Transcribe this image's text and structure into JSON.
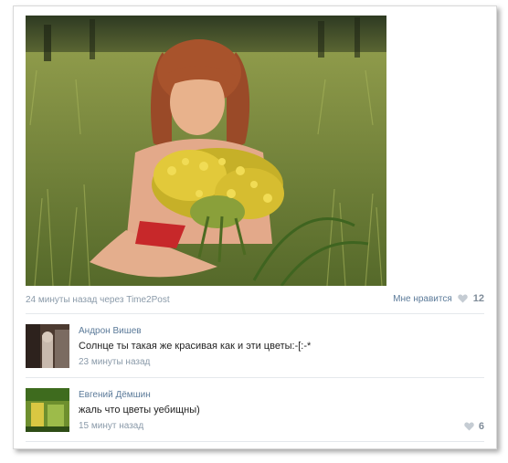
{
  "post": {
    "meta": "24 минуты назад через Time2Post",
    "like_label": "Мне нравится",
    "like_count": "12"
  },
  "comments": [
    {
      "author": "Андрон Вишев",
      "text": "Солнце ты такая же красивая как и эти цветы:-[:-*",
      "time": "23 минуты назад",
      "likes": ""
    },
    {
      "author": "Евгений Дёмшин",
      "text": "жаль что цветы уебищны)",
      "time": "15 минут назад",
      "likes": "6"
    }
  ],
  "colors": {
    "link": "#5b7a99",
    "muted": "#8a9aa9",
    "heart": "#c5ccd3"
  },
  "icons": [
    "heart-icon"
  ]
}
